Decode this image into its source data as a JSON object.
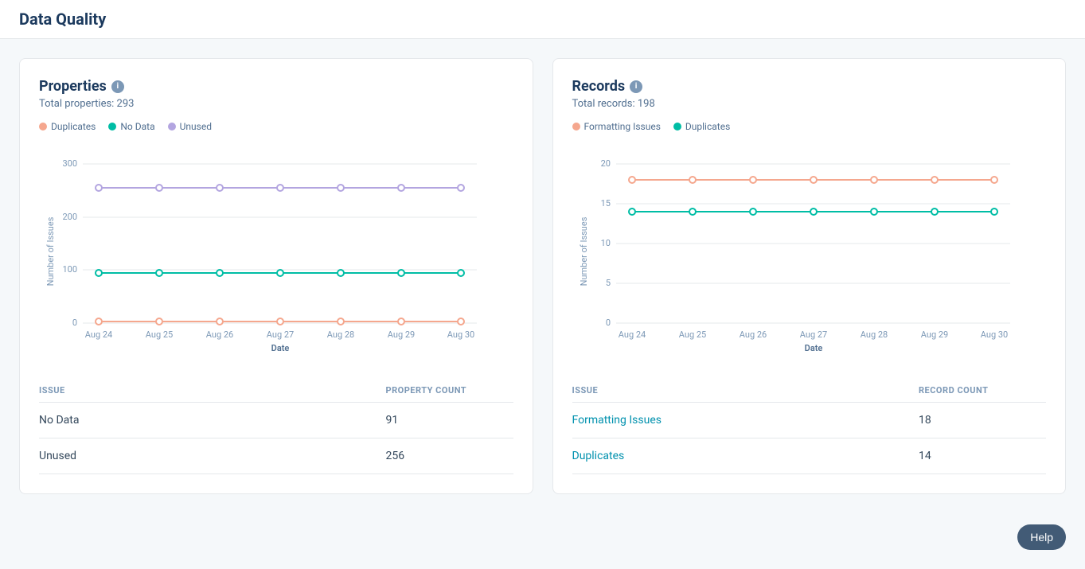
{
  "page": {
    "title": "Data Quality"
  },
  "properties_card": {
    "title": "Properties",
    "subtitle": "Total properties: 293",
    "legend": [
      {
        "label": "Duplicates",
        "color": "#f5a78e",
        "key": "duplicates"
      },
      {
        "label": "No Data",
        "color": "#00bda5",
        "key": "no_data"
      },
      {
        "label": "Unused",
        "color": "#b3a5e0",
        "key": "unused"
      }
    ],
    "chart": {
      "y_label": "Number of Issues",
      "x_label": "Date",
      "y_ticks": [
        0,
        100,
        200,
        300
      ],
      "x_ticks": [
        "Aug 24",
        "Aug 25",
        "Aug 26",
        "Aug 27",
        "Aug 28",
        "Aug 29",
        "Aug 30"
      ],
      "series": {
        "duplicates": {
          "color": "#f5a78e",
          "values": [
            2,
            2,
            2,
            2,
            2,
            2,
            2
          ]
        },
        "no_data": {
          "color": "#00bda5",
          "values": [
            95,
            95,
            95,
            95,
            95,
            95,
            95
          ]
        },
        "unused": {
          "color": "#b3a5e0",
          "values": [
            255,
            255,
            255,
            255,
            255,
            255,
            256
          ]
        }
      }
    },
    "table": {
      "col_issue": "ISSUE",
      "col_count": "PROPERTY COUNT",
      "rows": [
        {
          "issue": "No Data",
          "count": "91",
          "link": false
        },
        {
          "issue": "Unused",
          "count": "256",
          "link": false
        }
      ]
    }
  },
  "records_card": {
    "title": "Records",
    "subtitle": "Total records: 198",
    "legend": [
      {
        "label": "Formatting Issues",
        "color": "#f5a78e",
        "key": "formatting"
      },
      {
        "label": "Duplicates",
        "color": "#00bda5",
        "key": "duplicates"
      }
    ],
    "chart": {
      "y_label": "Number of Issues",
      "x_label": "Date",
      "y_ticks": [
        0,
        5,
        10,
        15,
        20
      ],
      "x_ticks": [
        "Aug 24",
        "Aug 25",
        "Aug 26",
        "Aug 27",
        "Aug 28",
        "Aug 29",
        "Aug 30"
      ],
      "series": {
        "formatting": {
          "color": "#f5a78e",
          "values": [
            18,
            18,
            18,
            18,
            18,
            18,
            18
          ]
        },
        "duplicates": {
          "color": "#00bda5",
          "values": [
            14,
            14,
            14,
            14,
            14,
            14,
            14
          ]
        }
      }
    },
    "table": {
      "col_issue": "ISSUE",
      "col_count": "RECORD COUNT",
      "rows": [
        {
          "issue": "Formatting Issues",
          "count": "18",
          "link": true
        },
        {
          "issue": "Duplicates",
          "count": "14",
          "link": true
        }
      ]
    }
  },
  "help_button": {
    "label": "Help"
  }
}
